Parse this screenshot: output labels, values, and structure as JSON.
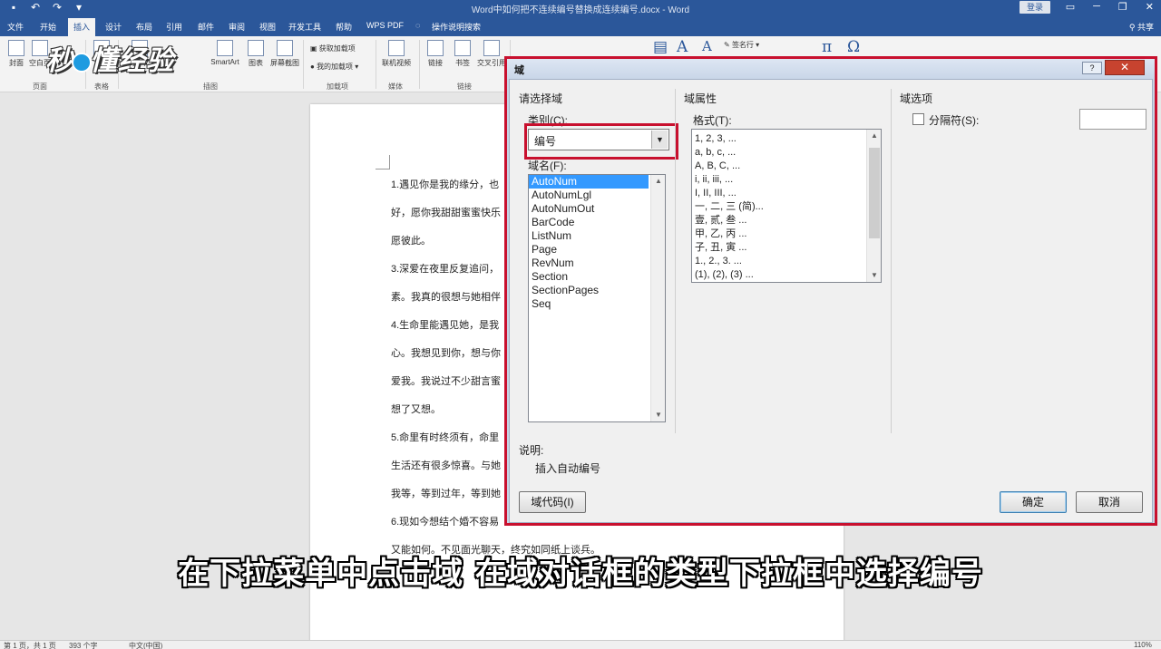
{
  "window": {
    "title": "Word中如何把不连续编号替换成连续编号.docx - Word",
    "login_label": "登录",
    "share_label": "共享"
  },
  "tabs": [
    "文件",
    "开始",
    "插入",
    "设计",
    "布局",
    "引用",
    "邮件",
    "审阅",
    "视图",
    "开发工具",
    "帮助",
    "WPS PDF",
    "操作说明搜索"
  ],
  "active_tab": "插入",
  "ribbon": {
    "buttons": [
      "封面",
      "空白页",
      "表格",
      "图片",
      "SmartArt",
      "图表",
      "屏幕截图",
      "联机视频",
      "链接",
      "书签",
      "交叉引用"
    ],
    "addins": [
      "获取加载项",
      "我的加载项"
    ],
    "groups": [
      "页面",
      "表格",
      "插图",
      "加载项",
      "媒体",
      "链接"
    ],
    "misc": [
      "签名行"
    ],
    "glyphs": [
      "A",
      "A",
      "π",
      "Ω"
    ]
  },
  "watermark": "秒懂经验",
  "document": {
    "lines": [
      "1.遇见你是我的缘分，也",
      "好，愿你我甜甜蜜蜜快乐",
      "愿彼此。",
      "3.深爱在夜里反复追问，",
      "素。我真的很想与她相伴",
      "4.生命里能遇见她，是我",
      "心。我想见到你，想与你",
      "爱我。我说过不少甜言蜜",
      "想了又想。",
      "5.命里有时终须有，命里",
      "生活还有很多惊喜。与她",
      "我等，等到过年，等到她",
      "6.现如今想结个婚不容易",
      "又能如何。不见面光聊天，终究如同纸上谈兵。"
    ]
  },
  "dialog": {
    "title": "域",
    "help_label": "?",
    "close_label": "✕",
    "choose_section": "请选择域",
    "category_label": "类别(C):",
    "category_value": "编号",
    "field_names_label": "域名(F):",
    "field_names": [
      "AutoNum",
      "AutoNumLgl",
      "AutoNumOut",
      "BarCode",
      "ListNum",
      "Page",
      "RevNum",
      "Section",
      "SectionPages",
      "Seq"
    ],
    "selected_field": "AutoNum",
    "props_section": "域属性",
    "format_label": "格式(T):",
    "formats": [
      "1, 2, 3, ...",
      "a, b, c, ...",
      "A, B, C, ...",
      "i, ii, iii, ...",
      "I, II, III, ...",
      "一, 二, 三 (简)...",
      "壹, 贰, 叁 ...",
      "甲, 乙, 丙 ...",
      "子, 丑, 寅 ...",
      "1., 2., 3. ...",
      "(1), (2), (3) ..."
    ],
    "options_section": "域选项",
    "separator_label": "分隔符(S):",
    "description_label": "说明:",
    "description_text": "插入自动编号",
    "field_codes_button": "域代码(I)",
    "ok_button": "确定",
    "cancel_button": "取消"
  },
  "status": {
    "page": "第 1 页，共 1 页",
    "words": "393 个字",
    "language": "中文(中国)",
    "zoom": "110%"
  },
  "subtitle": "在下拉菜单中点击域  在域对话框的类型下拉框中选择编号"
}
